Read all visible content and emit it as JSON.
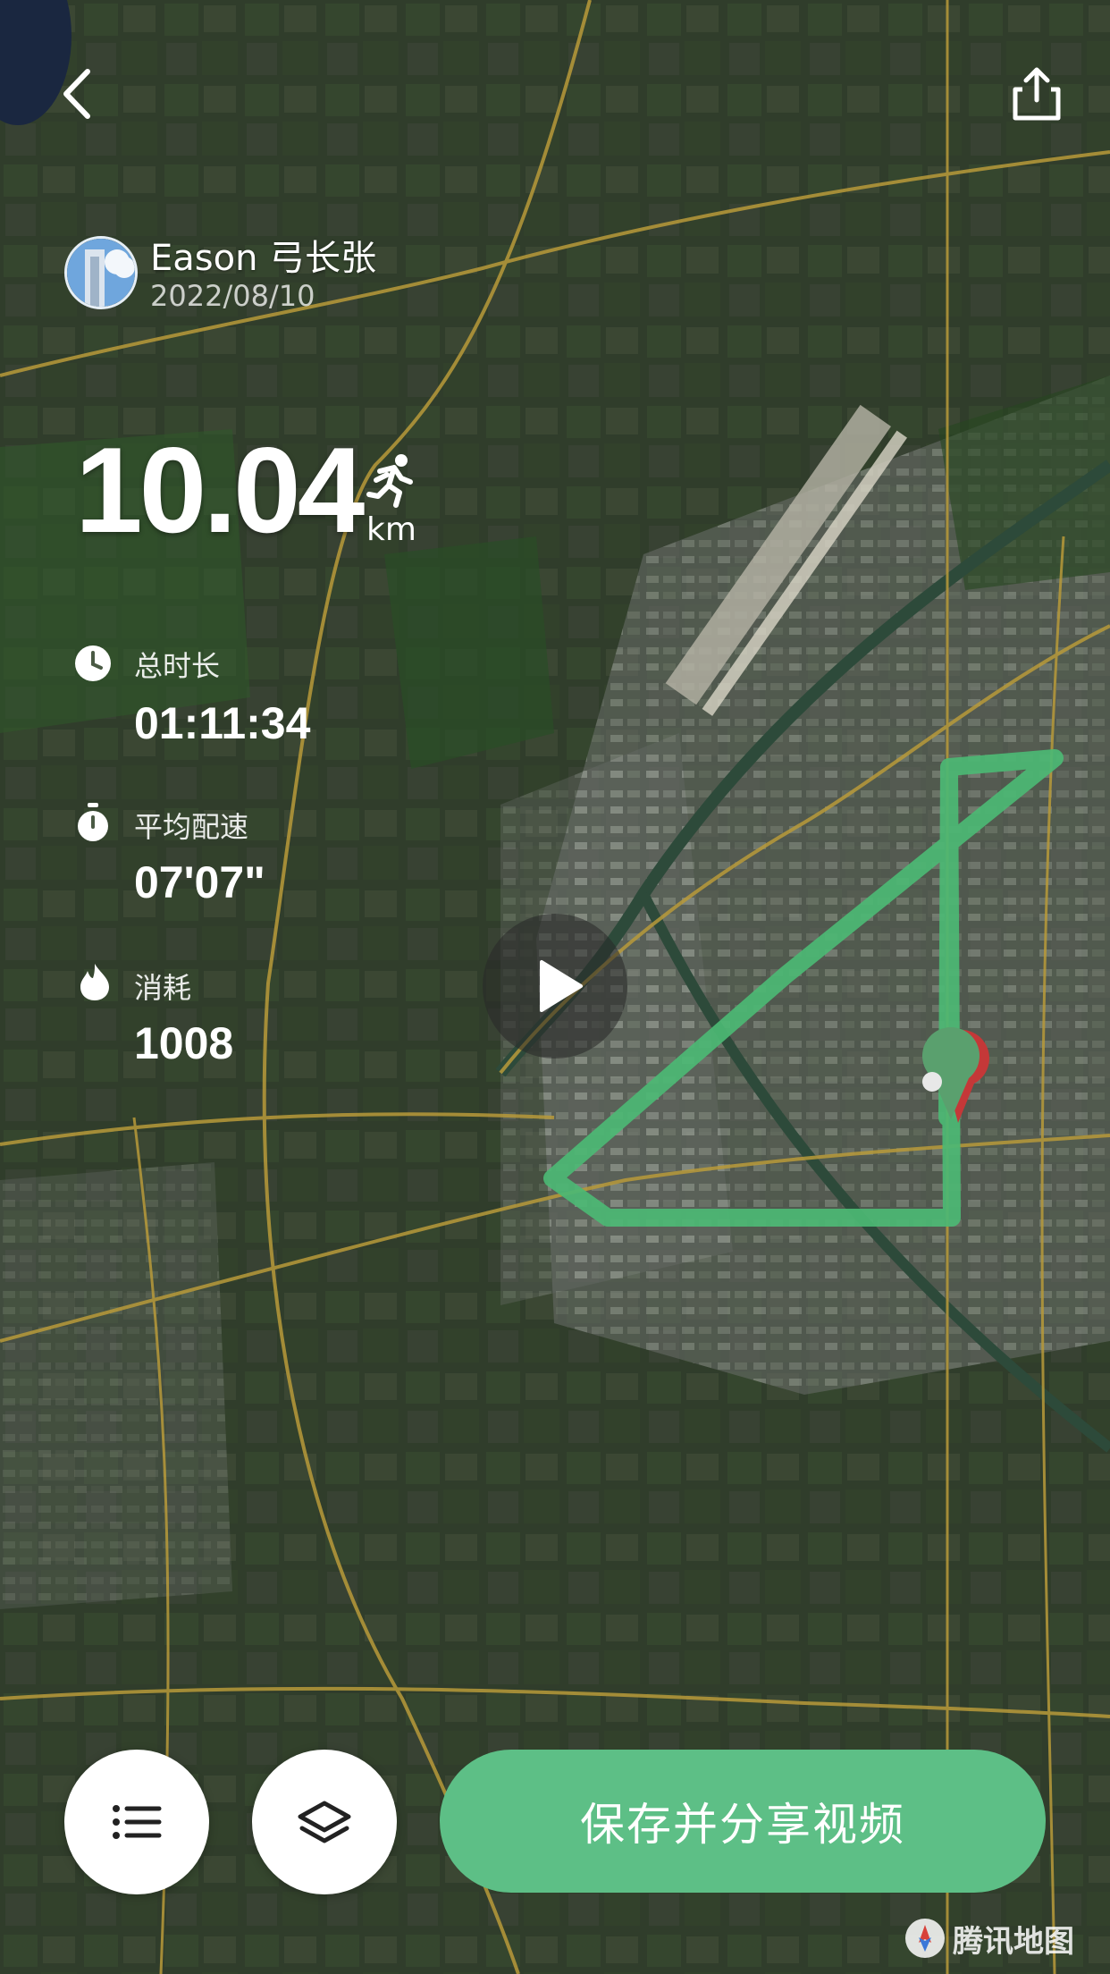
{
  "user": {
    "name": "Eason 弓长张",
    "date": "2022/08/10"
  },
  "distance": {
    "value": "10.04",
    "unit": "km"
  },
  "stats": [
    {
      "icon": "clock-icon",
      "label": "总时长",
      "value": "01:11:34"
    },
    {
      "icon": "stopwatch-icon",
      "label": "平均配速",
      "value": "07'07\""
    },
    {
      "icon": "flame-icon",
      "label": "消耗",
      "value": "1008"
    }
  ],
  "actions": {
    "save_share_label": "保存并分享视频"
  },
  "map": {
    "provider_label": "腾讯地图",
    "route_color": "#4cb874",
    "marker_color": "#5aa06e"
  },
  "icons": [
    "back-icon",
    "share-icon",
    "run-icon",
    "play-icon",
    "list-icon",
    "layers-icon"
  ]
}
